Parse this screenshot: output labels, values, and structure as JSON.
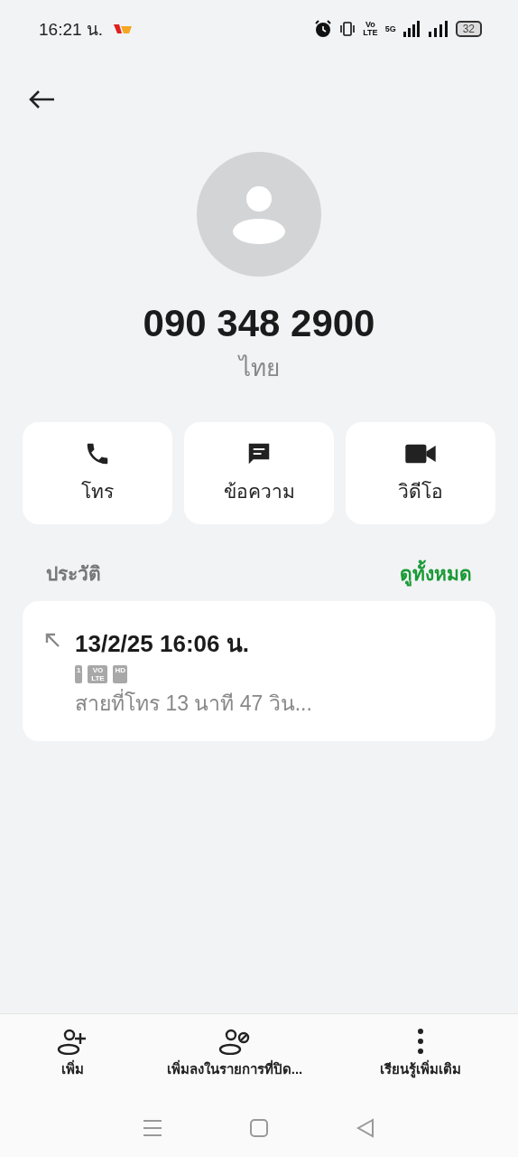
{
  "status_bar": {
    "time": "16:21 น.",
    "volte": [
      "Vo",
      "LTE"
    ],
    "network": "5G",
    "battery": "32"
  },
  "contact": {
    "number": "090 348 2900",
    "location": "ไทย"
  },
  "actions": [
    {
      "kind": "call",
      "label": "โทร"
    },
    {
      "kind": "message",
      "label": "ข้อความ"
    },
    {
      "kind": "video",
      "label": "วิดีโอ"
    }
  ],
  "history": {
    "title": "ประวัติ",
    "view_all": "ดูทั้งหมด",
    "entries": [
      {
        "kind": "outgoing",
        "datetime": "13/2/25 16:06 น.",
        "badges": [
          "1",
          "VO LTE",
          "HD"
        ],
        "detail": "สายที่โทร  13 นาที 47 วิน..."
      }
    ]
  },
  "bottom_actions": [
    {
      "kind": "add",
      "label": "เพิ่ม"
    },
    {
      "kind": "block",
      "label": "เพิ่มลงในรายการที่ปิด..."
    },
    {
      "kind": "more",
      "label": "เรียนรู้เพิ่มเติม"
    }
  ]
}
